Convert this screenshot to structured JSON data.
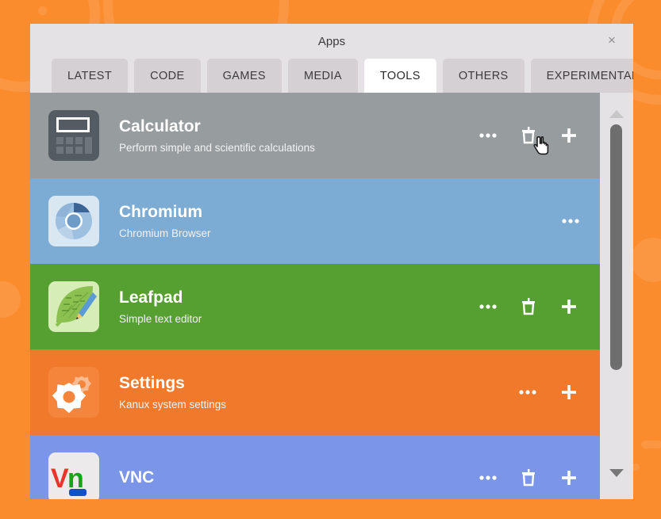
{
  "desktop": {
    "background_color": "#fb8c2e"
  },
  "dialog": {
    "title": "Apps",
    "close_label": "×",
    "background_color": "#e4e2e4"
  },
  "tabs": [
    {
      "label": "LATEST",
      "active": false
    },
    {
      "label": "CODE",
      "active": false
    },
    {
      "label": "GAMES",
      "active": false
    },
    {
      "label": "MEDIA",
      "active": false
    },
    {
      "label": "TOOLS",
      "active": true
    },
    {
      "label": "OTHERS",
      "active": false
    },
    {
      "label": "EXPERIMENTAL",
      "active": false
    }
  ],
  "apps": [
    {
      "name": "Calculator",
      "description": "Perform simple and scientific calculations",
      "row_color": "#64707099",
      "icon": "calculator-icon",
      "actions": [
        "more-icon",
        "trash-icon",
        "plus-icon"
      ]
    },
    {
      "name": "Chromium",
      "description": "Chromium Browser",
      "row_color": "#7cabd4",
      "icon": "chromium-icon",
      "actions": [
        "more-icon"
      ]
    },
    {
      "name": "Leafpad",
      "description": "Simple text editor",
      "row_color": "#56a032",
      "icon": "leafpad-icon",
      "actions": [
        "more-icon",
        "trash-icon",
        "plus-icon"
      ]
    },
    {
      "name": "Settings",
      "description": "Kanux system settings",
      "row_color": "#f0792c",
      "icon": "settings-icon",
      "actions": [
        "more-icon",
        "plus-icon"
      ]
    },
    {
      "name": "VNC",
      "description": "",
      "row_color": "#7b95e8",
      "icon": "vnc-icon",
      "actions": [
        "more-icon",
        "trash-icon",
        "plus-icon"
      ]
    }
  ],
  "scrollbar": {
    "up_arrow": "chevron-up-icon",
    "down_arrow": "chevron-down-icon"
  },
  "cursor": {
    "type": "pointing-hand"
  }
}
